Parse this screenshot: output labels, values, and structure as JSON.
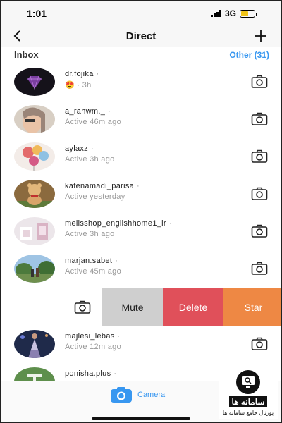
{
  "status_bar": {
    "time": "1:01",
    "network": "3G"
  },
  "nav": {
    "title": "Direct"
  },
  "inbox": {
    "title": "Inbox",
    "other_label": "Other (31)"
  },
  "threads": [
    {
      "name": "dr.fojika",
      "sub": "😍 · 3h",
      "avatar": "diamond-avatar"
    },
    {
      "name": "a_rahwm._",
      "sub": "Active 46m ago",
      "avatar": "face-avatar"
    },
    {
      "name": "aylaxz",
      "sub": "Active 3h ago",
      "avatar": "balloons-avatar"
    },
    {
      "name": "kafenamadi_parisa",
      "sub": "Active yesterday",
      "avatar": "toy-avatar"
    },
    {
      "name": "melisshop_englishhome1_ir",
      "sub": "Active 3h ago",
      "avatar": "shop-avatar"
    },
    {
      "name": "marjan.sabet",
      "sub": "Active 45m ago",
      "avatar": "park-avatar"
    },
    {
      "name": "majlesi_lebas",
      "sub": "Active 12m ago",
      "avatar": "fashion-avatar"
    },
    {
      "name": "ponisha.plus",
      "sub": "",
      "avatar": "logo-avatar"
    }
  ],
  "swipe_actions": {
    "mute": "Mute",
    "delete": "Delete",
    "star": "Star"
  },
  "bottom": {
    "camera_label": "Camera"
  },
  "watermark": {
    "title": "سامانه ها",
    "subtitle": "پورتال جامع سامانه ها"
  },
  "colors": {
    "accent": "#3897f0",
    "delete": "#e0505a",
    "star": "#ee8844",
    "mute": "#cfcfcf"
  }
}
